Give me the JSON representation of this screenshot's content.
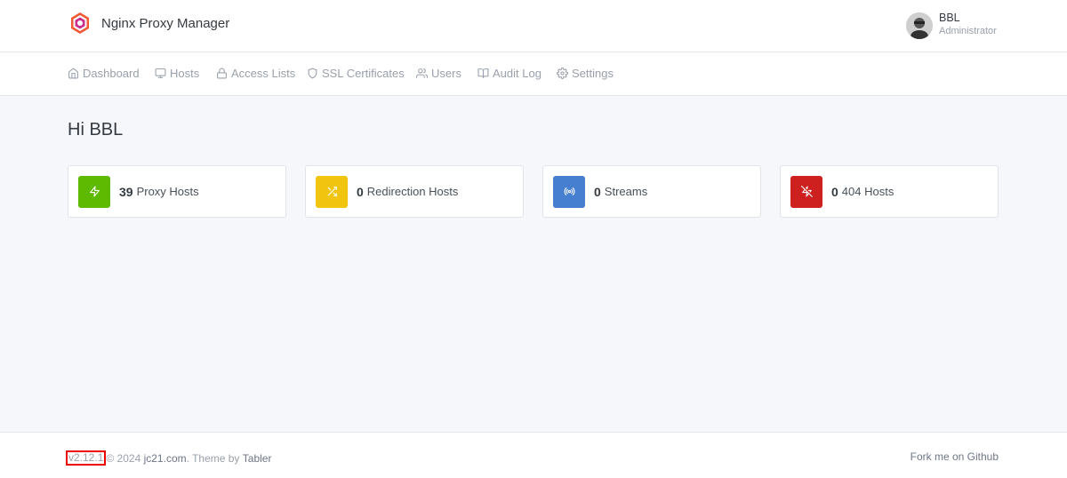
{
  "app": {
    "title": "Nginx Proxy Manager"
  },
  "user": {
    "name": "BBL",
    "role": "Administrator"
  },
  "nav": {
    "items": [
      {
        "label": "Dashboard",
        "icon": "home-icon"
      },
      {
        "label": "Hosts",
        "icon": "monitor-icon"
      },
      {
        "label": "Access Lists",
        "icon": "lock-icon"
      },
      {
        "label": "SSL Certificates",
        "icon": "shield-icon"
      },
      {
        "label": "Users",
        "icon": "users-icon"
      },
      {
        "label": "Audit Log",
        "icon": "book-icon"
      },
      {
        "label": "Settings",
        "icon": "gear-icon"
      }
    ]
  },
  "main": {
    "greeting": "Hi BBL",
    "cards": [
      {
        "count": "39",
        "label": "Proxy Hosts",
        "color": "#5eba00",
        "icon": "zap-icon"
      },
      {
        "count": "0",
        "label": "Redirection Hosts",
        "color": "#f1c40f",
        "icon": "shuffle-icon"
      },
      {
        "count": "0",
        "label": "Streams",
        "color": "#467fcf",
        "icon": "radio-icon"
      },
      {
        "count": "0",
        "label": "404 Hosts",
        "color": "#cd201f",
        "icon": "zap-off-icon"
      }
    ]
  },
  "footer": {
    "version": "v2.12.1",
    "copyright": "© 2024 ",
    "company_link": "jc21.com",
    "theme_text": ". Theme by ",
    "theme_link": "Tabler",
    "github_link": "Fork me on Github"
  }
}
